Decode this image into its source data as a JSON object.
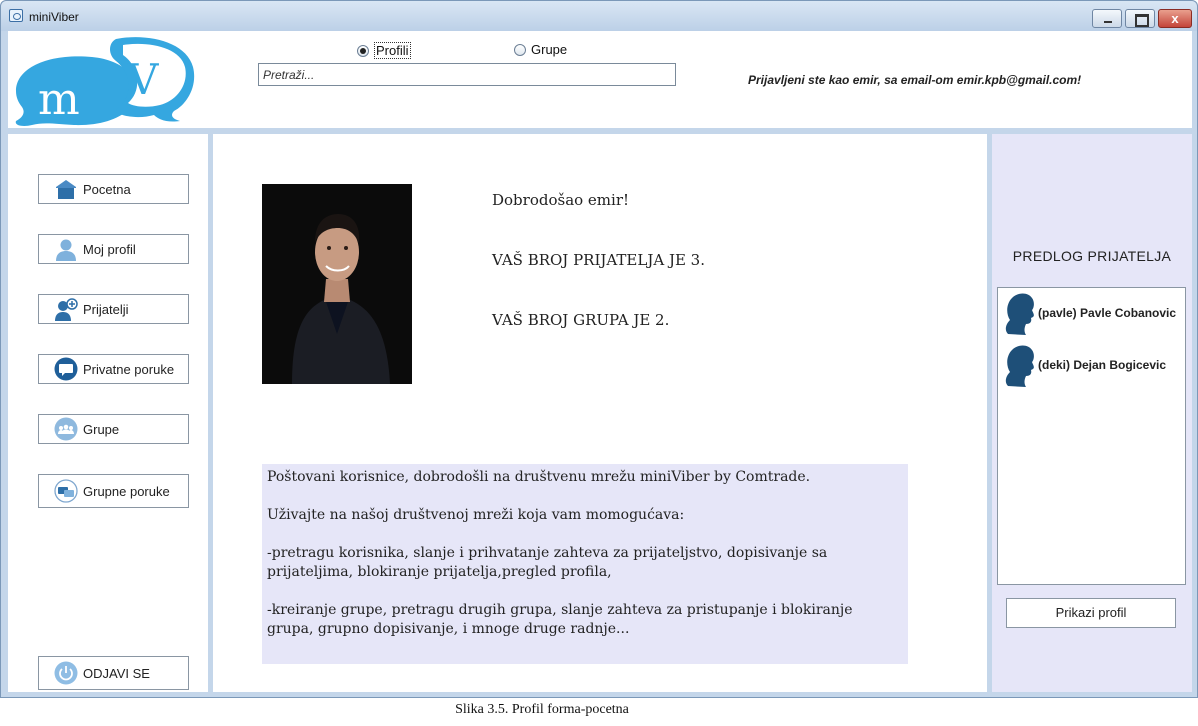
{
  "window": {
    "title": "miniViber",
    "close_glyph": "x"
  },
  "header": {
    "logo_text": "mV",
    "radio_profiles": "Profili",
    "radio_groups": "Grupe",
    "selected_radio": "Profili",
    "search_placeholder": "Pretraži...",
    "logged_in_text": "Prijavljeni ste kao emir, sa email-om emir.kpb@gmail.com!"
  },
  "sidebar": {
    "items": [
      {
        "label": "Pocetna",
        "icon": "home-icon"
      },
      {
        "label": "Moj profil",
        "icon": "user-icon"
      },
      {
        "label": "Prijatelji",
        "icon": "friends-icon"
      },
      {
        "label": "Privatne poruke",
        "icon": "chat-icon"
      },
      {
        "label": "Grupe",
        "icon": "group-icon"
      },
      {
        "label": "Grupne poruke",
        "icon": "group-chat-icon"
      }
    ],
    "logout_label": "ODJAVI SE"
  },
  "main": {
    "welcome": "Dobrodošao emir!",
    "friends_count": "VAŠ BROJ PRIJATELJA JE 3.",
    "groups_count": "VAŠ BROJ GRUPA JE 2.",
    "info_paragraphs": [
      "Poštovani korisnice, dobrodošli na društvenu mrežu miniViber by Comtrade.",
      "Uživajte na našoj društvenoj mreži koja vam momogućava:",
      "-pretragu korisnika, slanje i prihvatanje zahteva za prijateljstvo, dopisivanje sa prijateljima, blokiranje prijatelja,pregled profila,",
      "-kreiranje grupe, pretragu drugih grupa, slanje zahteva za pristupanje i blokiranje grupa, grupno dopisivanje, i mnoge druge radnje..."
    ]
  },
  "suggestions": {
    "title": "PREDLOG PRIJATELJA",
    "items": [
      {
        "label": "(pavle) Pavle Cobanovic",
        "icon": "user-silhouette-icon"
      },
      {
        "label": "(deki) Dejan Bogicevic",
        "icon": "user-silhouette-icon"
      }
    ],
    "button_label": "Prikazi profil"
  },
  "caption": "Slika 3.5. Profil forma-pocetna",
  "colors": {
    "frame": "#c4d6ea",
    "panel_lavender": "#e6e6f8",
    "logo_blue": "#35a7e0",
    "icon_blue": "#2e6fa8"
  }
}
